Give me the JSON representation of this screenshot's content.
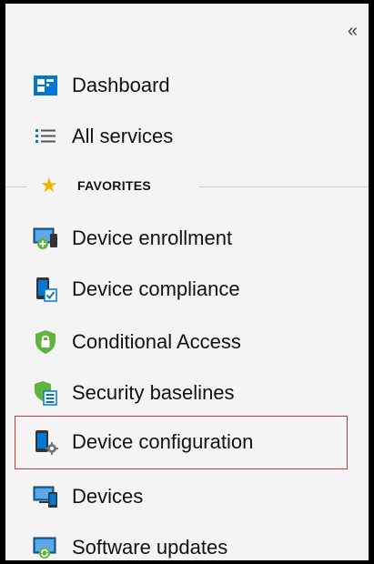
{
  "nav": {
    "collapse_glyph": "«",
    "top_items": [
      {
        "label": "Dashboard",
        "icon": "dashboard-icon"
      },
      {
        "label": "All services",
        "icon": "list-icon"
      }
    ],
    "favorites_label": "FAVORITES",
    "favorites_icon": "star-icon",
    "favorites": [
      {
        "label": "Device enrollment",
        "icon": "device-enrollment-icon"
      },
      {
        "label": "Device compliance",
        "icon": "device-compliance-icon"
      },
      {
        "label": "Conditional Access",
        "icon": "conditional-access-icon"
      },
      {
        "label": "Security baselines",
        "icon": "security-baselines-icon"
      },
      {
        "label": "Device configuration",
        "icon": "device-configuration-icon",
        "highlighted": true
      },
      {
        "label": "Devices",
        "icon": "devices-icon"
      },
      {
        "label": "Software updates",
        "icon": "software-updates-icon"
      }
    ]
  },
  "colors": {
    "panel_bg": "#f4f4f4",
    "highlight_border": "#d13438",
    "star": "#f2b400",
    "icon_blue": "#0078d4",
    "icon_green": "#5fb43c"
  }
}
